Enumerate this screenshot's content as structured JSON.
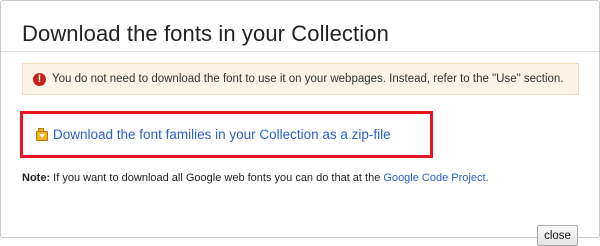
{
  "dialog": {
    "title": "Download the fonts in your Collection",
    "warning": {
      "icon": "exclamation-icon",
      "text": "You do not need to download the font to use it on your webpages. Instead, refer to the \"Use\" section."
    },
    "download": {
      "icon": "zip-file-icon",
      "link_text": "Download the font families in your Collection as a zip-file",
      "highlight_color": "#e8141d"
    },
    "note": {
      "label": "Note:",
      "text": " If you want to download all Google web fonts you can do that at the ",
      "link_text": "Google Code Project",
      "suffix": "."
    },
    "close_label": "close"
  },
  "colors": {
    "link": "#2a62c9",
    "warning_bg": "#fcf3e6",
    "warning_icon": "#c4211b"
  }
}
